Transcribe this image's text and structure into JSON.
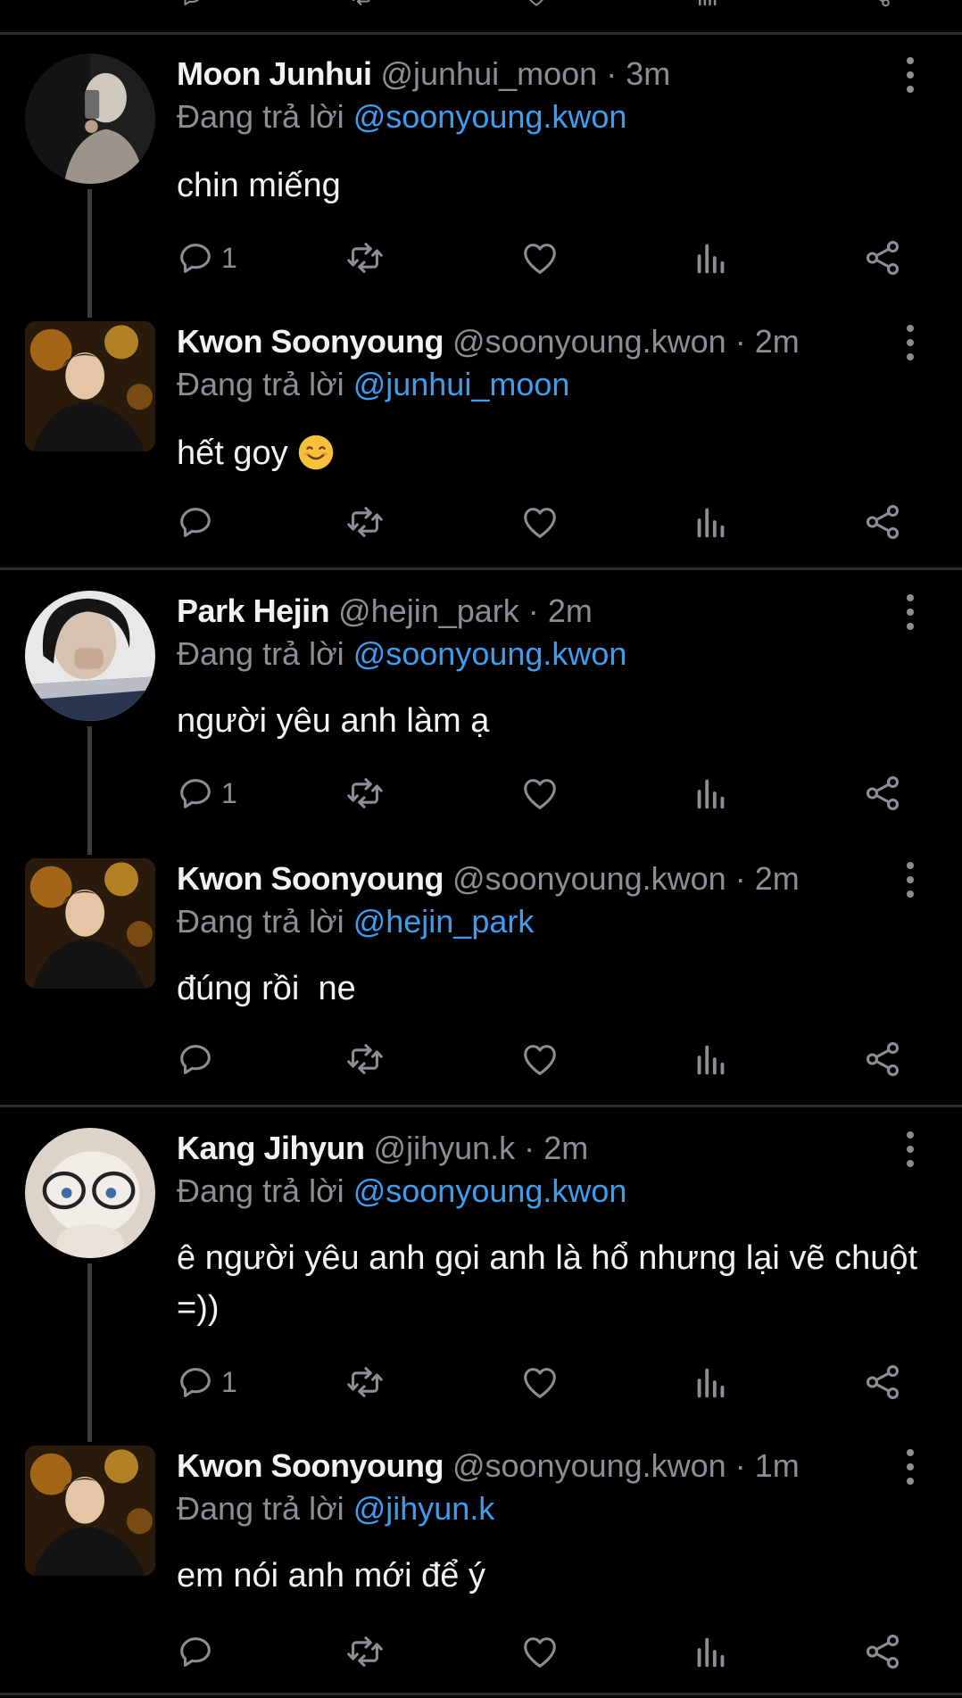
{
  "colors": {
    "background": "#000000",
    "name": "#f2f2f2",
    "secondary": "#8b8f94",
    "mention": "#3b9ef0",
    "divider": "#2a2d30"
  },
  "icons": [
    "reply-icon",
    "retweet-icon",
    "like-icon",
    "views-icon",
    "share-icon",
    "more-options-icon"
  ],
  "reply_prefix": "Đang trả lời",
  "tweets": [
    {
      "name": "Moon Junhui",
      "handle": "@junhui_moon",
      "time": "3m",
      "reply_to": "@soonyoung.kwon",
      "text": "chin miếng",
      "reply_count": "1"
    },
    {
      "name": "Kwon Soonyoung",
      "handle": "@soonyoung.kwon",
      "time": "2m",
      "reply_to": "@junhui_moon",
      "text": "hết goy",
      "reply_count": ""
    },
    {
      "name": "Park Hejin",
      "handle": "@hejin_park",
      "time": "2m",
      "reply_to": "@soonyoung.kwon",
      "text": "người yêu anh làm ạ",
      "reply_count": "1"
    },
    {
      "name": "Kwon Soonyoung",
      "handle": "@soonyoung.kwon",
      "time": "2m",
      "reply_to": "@hejin_park",
      "text": "đúng rồi  ne",
      "reply_count": ""
    },
    {
      "name": "Kang Jihyun",
      "handle": "@jihyun.k",
      "time": "2m",
      "reply_to": "@soonyoung.kwon",
      "text": "ê người yêu anh gọi anh là hổ nhưng lại vẽ chuột =))",
      "reply_count": "1"
    },
    {
      "name": "Kwon Soonyoung",
      "handle": "@soonyoung.kwon",
      "time": "1m",
      "reply_to": "@jihyun.k",
      "text": "em nói anh mới để ý",
      "reply_count": ""
    }
  ]
}
